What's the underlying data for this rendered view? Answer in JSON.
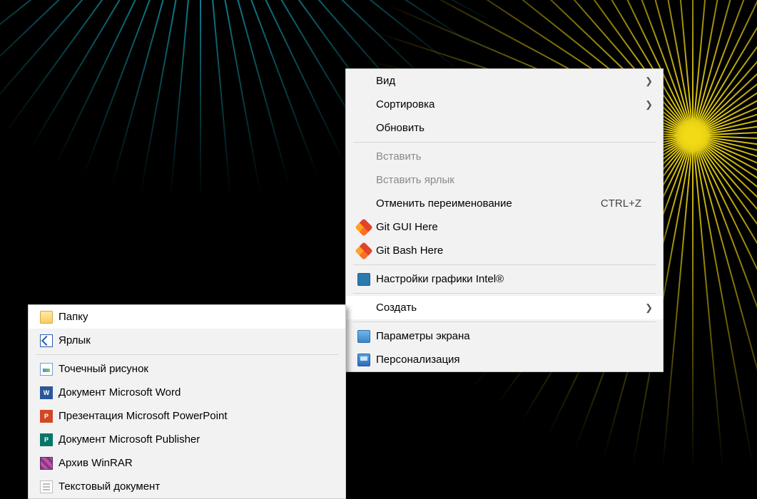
{
  "main_menu": {
    "view": {
      "label": "Вид"
    },
    "sort": {
      "label": "Сортировка"
    },
    "refresh": {
      "label": "Обновить"
    },
    "paste": {
      "label": "Вставить"
    },
    "paste_link": {
      "label": "Вставить ярлык"
    },
    "undo": {
      "label": "Отменить переименование",
      "shortcut": "CTRL+Z"
    },
    "git_gui": {
      "label": "Git GUI Here"
    },
    "git_bash": {
      "label": "Git Bash Here"
    },
    "intel": {
      "label": "Настройки графики Intel®"
    },
    "create": {
      "label": "Создать"
    },
    "display": {
      "label": "Параметры экрана"
    },
    "personalize": {
      "label": "Персонализация"
    }
  },
  "sub_menu": {
    "folder": {
      "label": "Папку"
    },
    "shortcut": {
      "label": "Ярлык"
    },
    "bmp": {
      "label": "Точечный рисунок"
    },
    "word": {
      "label": "Документ Microsoft Word"
    },
    "ppt": {
      "label": "Презентация Microsoft PowerPoint"
    },
    "pub": {
      "label": "Документ Microsoft Publisher"
    },
    "rar": {
      "label": "Архив WinRAR"
    },
    "txt": {
      "label": "Текстовый документ"
    }
  }
}
